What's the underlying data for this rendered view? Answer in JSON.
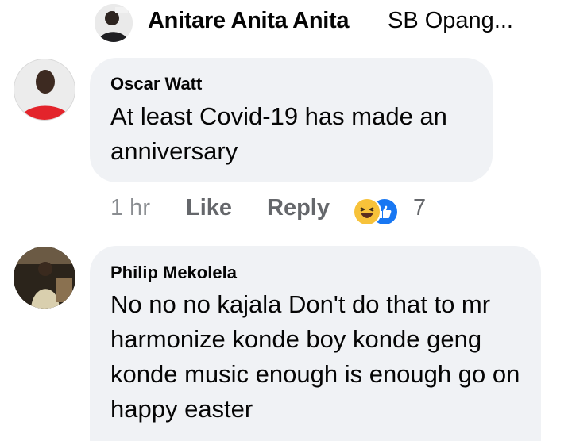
{
  "top_reply": {
    "author": "Anitare Anita Anita",
    "snippet": "SB Opang..."
  },
  "comments": [
    {
      "author": "Oscar Watt",
      "text": "At least Covid-19 has made an anniversary",
      "time": "1 hr",
      "like_label": "Like",
      "reply_label": "Reply",
      "reactions": [
        "haha-icon",
        "like-icon"
      ],
      "reaction_count": "7"
    },
    {
      "author": "Philip Mekolela",
      "text": "No no no kajala Don't do that to mr harmonize konde boy konde geng konde music enough is enough go on happy easter"
    }
  ],
  "colors": {
    "bubble": "#f0f2f5",
    "meta_text": "#65676b",
    "accent_blue": "#1877f2",
    "haha_yellow": "#f7c23a"
  }
}
